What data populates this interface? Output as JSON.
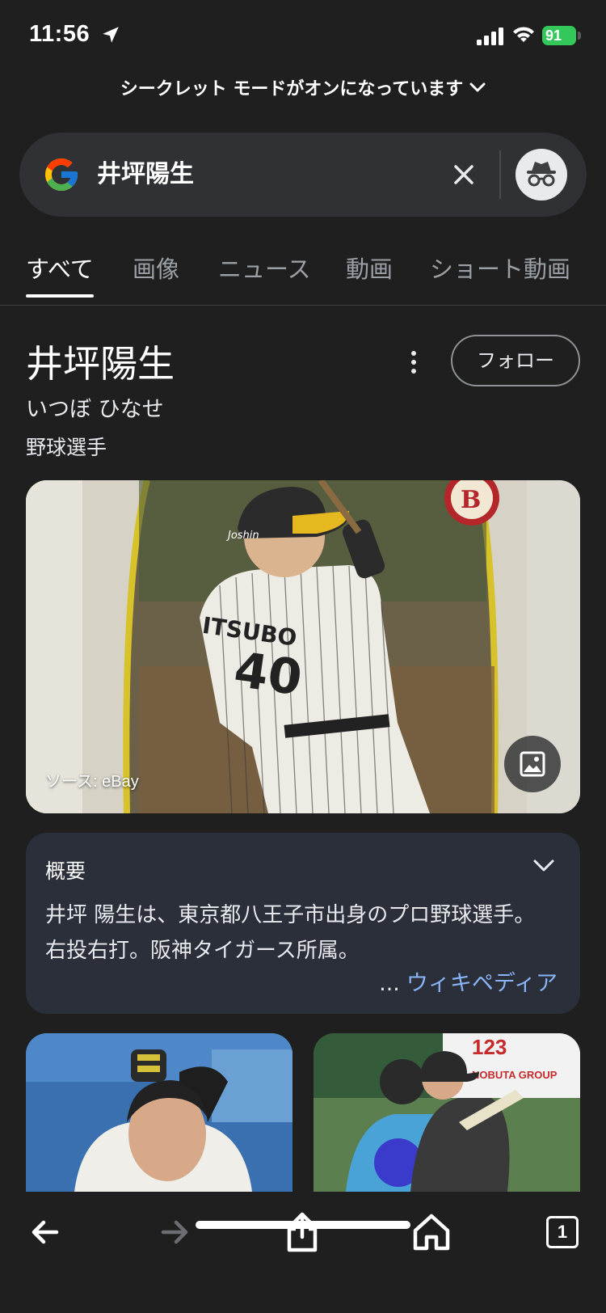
{
  "status": {
    "time": "11:56",
    "battery": "91"
  },
  "banner": {
    "text": "シークレット モードがオンになっています"
  },
  "search": {
    "query": "井坪陽生"
  },
  "tabs": [
    {
      "label": "すべて",
      "active": true
    },
    {
      "label": "画像"
    },
    {
      "label": "ニュース"
    },
    {
      "label": "動画"
    },
    {
      "label": "ショート動画"
    }
  ],
  "knowledge_panel": {
    "title": "井坪陽生",
    "reading": "いつぼ ひなせ",
    "type": "野球選手",
    "follow_label": "フォロー",
    "image_source": "ソース: eBay"
  },
  "summary": {
    "heading": "概要",
    "body": "井坪 陽生は、東京都八王子市出身のプロ野球選手。右投右打。阪神タイガース所属。",
    "ellipsis": "...",
    "link_label": "ウィキペディア"
  },
  "toolbar": {
    "tab_count": "1"
  },
  "colors": {
    "background": "#1f1f1f",
    "search_bar": "#303134",
    "summary_card": "#2a2f3a",
    "link": "#8ab4f8",
    "battery": "#34c759"
  },
  "icons": [
    "location-arrow-icon",
    "signal-icon",
    "wifi-icon",
    "battery-icon",
    "google-g-icon",
    "close-icon",
    "incognito-icon",
    "more-vert-icon",
    "image-search-icon",
    "chevron-down-icon",
    "back-icon",
    "forward-icon",
    "share-icon",
    "home-icon",
    "tab-switcher-icon"
  ]
}
